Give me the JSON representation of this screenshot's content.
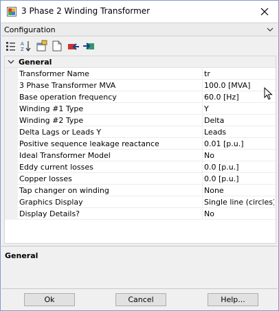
{
  "window": {
    "title": "3 Phase 2 Winding Transformer",
    "icon": "transformer-app-icon",
    "close_icon": "close-icon"
  },
  "configuration": {
    "label": "Configuration",
    "selected": "Configuration"
  },
  "toolbar": {
    "icons": [
      "categorized-icon",
      "alphabetical-sort-icon",
      "properties-icon",
      "new-page-icon",
      "import-icon",
      "export-icon"
    ]
  },
  "grid": {
    "section": "General",
    "rows": [
      {
        "name": "Transformer Name",
        "value": "tr"
      },
      {
        "name": "3 Phase Transformer MVA",
        "value": "100.0 [MVA]"
      },
      {
        "name": "Base operation frequency",
        "value": "60.0 [Hz]"
      },
      {
        "name": "Winding #1 Type",
        "value": "Y"
      },
      {
        "name": "Winding #2 Type",
        "value": "Delta"
      },
      {
        "name": "Delta Lags or Leads Y",
        "value": "Leads"
      },
      {
        "name": "Positive sequence leakage reactance",
        "value": "0.01 [p.u.]"
      },
      {
        "name": "Ideal Transformer Model",
        "value": "No"
      },
      {
        "name": "Eddy current losses",
        "value": "0.0 [p.u.]"
      },
      {
        "name": "Copper losses",
        "value": "0.0 [p.u.]"
      },
      {
        "name": "Tap changer on winding",
        "value": "None"
      },
      {
        "name": "Graphics Display",
        "value": "Single line (circles)"
      },
      {
        "name": "Display Details?",
        "value": "No"
      }
    ]
  },
  "description": {
    "title": "General"
  },
  "buttons": {
    "ok": "Ok",
    "cancel": "Cancel",
    "help": "Help..."
  },
  "colors": {
    "window_border": "#7a9cc9",
    "grid_background": "#ffffff",
    "panel_background": "#f0f0f0",
    "button_face": "#e1e1e1"
  }
}
